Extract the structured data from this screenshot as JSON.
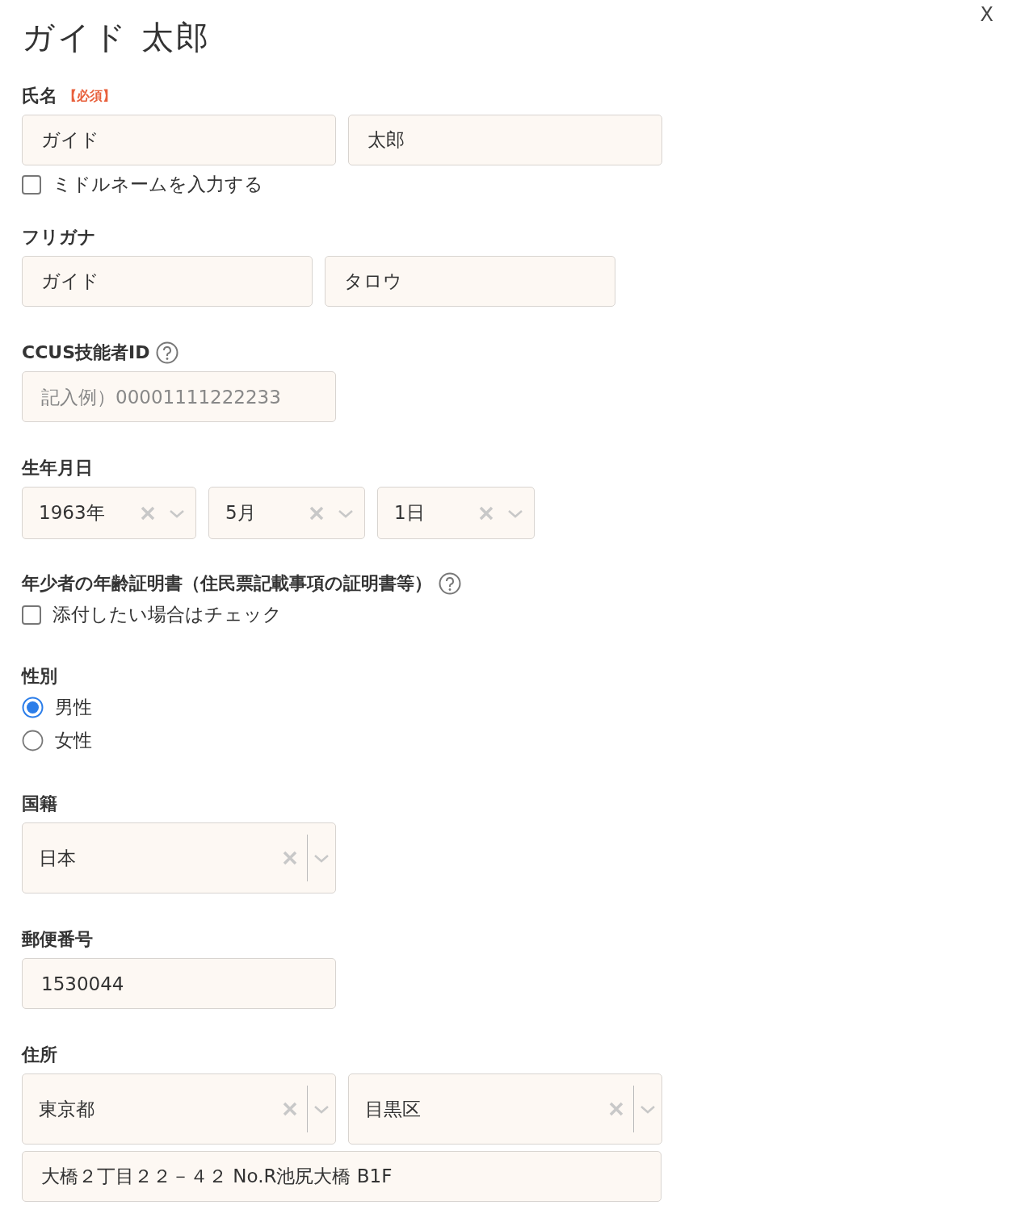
{
  "title": "ガイド 太郎",
  "close": "X",
  "sections": [
    {
      "kind": "name",
      "label": "氏名",
      "badge": "【必須】",
      "rows": [
        [
          {
            "kind": "input",
            "value": "ガイド"
          },
          {
            "kind": "input",
            "value": "太郎"
          }
        ],
        [
          {
            "kind": "checkbox",
            "label": "ミドルネームを入力する",
            "checked": false
          }
        ]
      ]
    },
    {
      "kind": "furigana",
      "label": "フリガナ",
      "rows": [
        [
          {
            "kind": "input",
            "value": "ガイド"
          },
          {
            "kind": "input",
            "value": "タロウ"
          }
        ]
      ]
    },
    {
      "kind": "ccus",
      "label": "CCUS技能者ID",
      "help": true,
      "rows": [
        [
          {
            "kind": "input",
            "placeholder": "記入例）00001111222233"
          }
        ]
      ]
    },
    {
      "kind": "date",
      "label": "生年月日",
      "rows": [
        [
          {
            "kind": "select",
            "value": "1963年"
          },
          {
            "kind": "select",
            "value": "5月"
          },
          {
            "kind": "select",
            "value": "1日"
          }
        ]
      ]
    },
    {
      "kind": "doc",
      "label": "年少者の年齢証明書（住民票記載事項の証明書等）",
      "help": true,
      "rows": [
        [
          {
            "kind": "checkbox",
            "label": "添付したい場合はチェック",
            "checked": false
          }
        ]
      ]
    },
    {
      "kind": "gender",
      "label": "性別",
      "rows": [
        [
          {
            "kind": "radio",
            "label": "男性",
            "selected": true
          }
        ],
        [
          {
            "kind": "radio",
            "label": "女性",
            "selected": false
          }
        ]
      ]
    },
    {
      "kind": "nation",
      "label": "国籍",
      "rows": [
        [
          {
            "kind": "bigselect",
            "value": "日本"
          }
        ]
      ]
    },
    {
      "kind": "postal",
      "label": "郵便番号",
      "rows": [
        [
          {
            "kind": "input",
            "value": "1530044"
          }
        ]
      ]
    },
    {
      "kind": "address",
      "label": "住所",
      "rows": [
        [
          {
            "kind": "bigselect",
            "value": "東京都"
          },
          {
            "kind": "bigselect",
            "value": "目黒区"
          }
        ],
        [
          {
            "kind": "input",
            "value": "大橋２丁目２２－４２ No.R池尻大橋 B1F"
          }
        ]
      ]
    }
  ]
}
